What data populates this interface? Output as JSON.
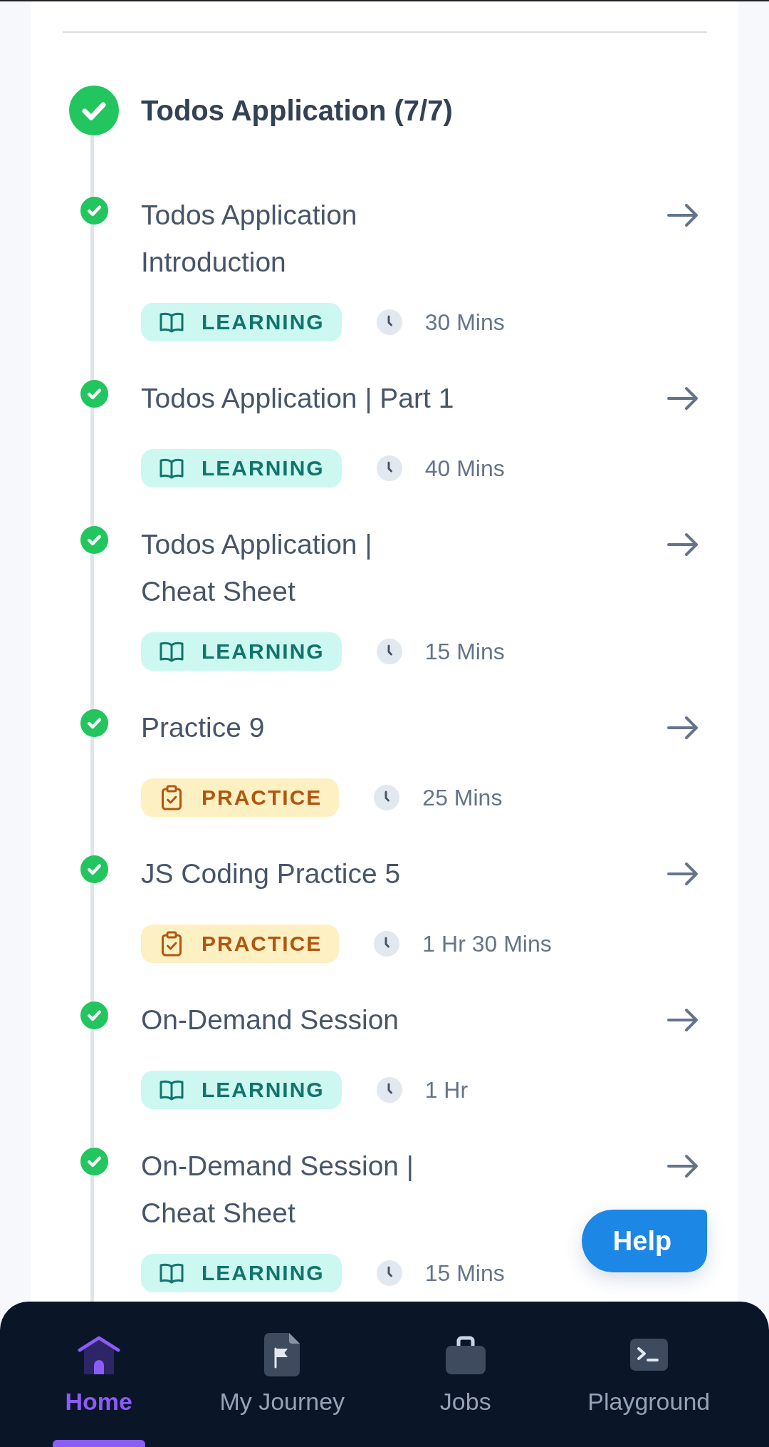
{
  "section": {
    "title": "Todos Application (7/7)",
    "completed": true
  },
  "items": [
    {
      "title": "Todos Application\nIntroduction",
      "completed": true,
      "badge": {
        "kind": "learning",
        "label": "LEARNING"
      },
      "duration": "30 Mins"
    },
    {
      "title": "Todos Application | Part 1",
      "completed": true,
      "badge": {
        "kind": "learning",
        "label": "LEARNING"
      },
      "duration": "40 Mins"
    },
    {
      "title": "Todos Application |\nCheat Sheet",
      "completed": true,
      "badge": {
        "kind": "learning",
        "label": "LEARNING"
      },
      "duration": "15 Mins"
    },
    {
      "title": "Practice 9",
      "completed": true,
      "badge": {
        "kind": "practice",
        "label": "PRACTICE"
      },
      "duration": "25 Mins"
    },
    {
      "title": "JS Coding Practice 5",
      "completed": true,
      "badge": {
        "kind": "practice",
        "label": "PRACTICE"
      },
      "duration": "1 Hr 30 Mins"
    },
    {
      "title": "On-Demand Session",
      "completed": true,
      "badge": {
        "kind": "learning",
        "label": "LEARNING"
      },
      "duration": "1 Hr"
    },
    {
      "title": "On-Demand Session |\nCheat Sheet",
      "completed": true,
      "badge": {
        "kind": "learning",
        "label": "LEARNING"
      },
      "duration": "15 Mins"
    }
  ],
  "help_button": {
    "label": "Help"
  },
  "bottom_nav": [
    {
      "kind": "home",
      "label": "Home",
      "selected": true
    },
    {
      "kind": "journey",
      "label": "My Journey",
      "selected": false
    },
    {
      "kind": "jobs",
      "label": "Jobs",
      "selected": false
    },
    {
      "kind": "playground",
      "label": "Playground",
      "selected": false
    }
  ]
}
